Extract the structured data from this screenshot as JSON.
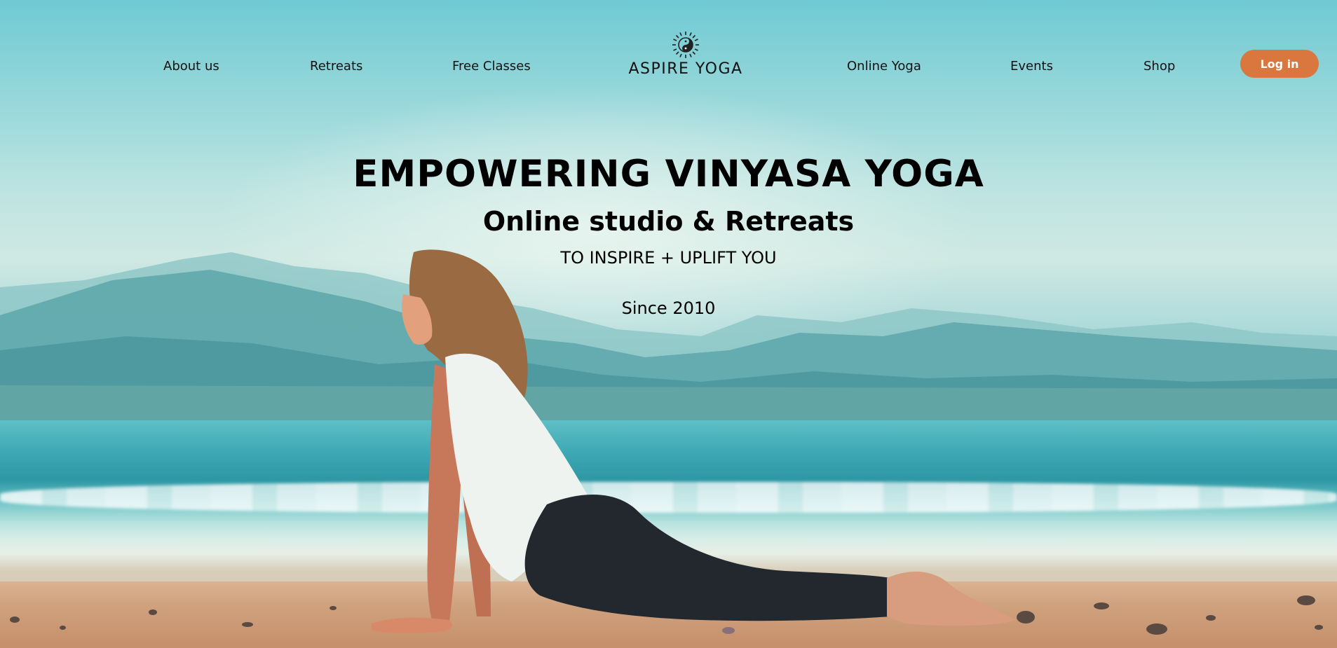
{
  "header": {
    "nav_left": [
      "About us",
      "Retreats",
      "Free Classes"
    ],
    "logo": {
      "text": "ASPIRE YOGA",
      "icon": "yin-yang-sun-icon"
    },
    "nav_right": [
      "Online Yoga",
      "Events",
      "Shop"
    ],
    "login_label": "Log in"
  },
  "hero": {
    "title": "EMPOWERING VINYASA YOGA",
    "subtitle": "Online studio & Retreats",
    "tagline": "TO INSPIRE + UPLIFT YOU",
    "since": "Since 2010",
    "image": "woman doing upward dog pose on beach with mountains and sea"
  },
  "colors": {
    "accent": "#d9773f",
    "sky": "#6fcad3",
    "text": "#000000"
  }
}
